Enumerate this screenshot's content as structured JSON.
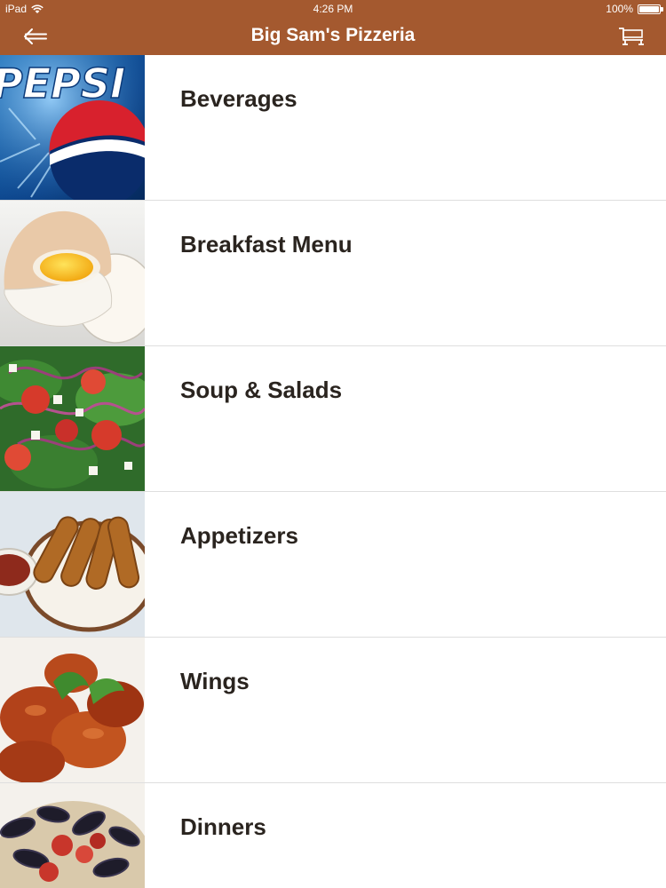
{
  "status_bar": {
    "device": "iPad",
    "time": "4:26 PM",
    "battery": "100%"
  },
  "header": {
    "title": "Big Sam's Pizzeria",
    "back_icon": "back-arrow-icon",
    "cart_icon": "shopping-cart-icon",
    "background_color": "#a4592f"
  },
  "menu": {
    "items": [
      {
        "label": "Beverages",
        "image": "pepsi-image"
      },
      {
        "label": "Breakfast Menu",
        "image": "egg-image"
      },
      {
        "label": "Soup & Salads",
        "image": "salad-image"
      },
      {
        "label": "Appetizers",
        "image": "mozzarella-sticks-image"
      },
      {
        "label": "Wings",
        "image": "wings-image"
      },
      {
        "label": "Dinners",
        "image": "mussels-pasta-image"
      }
    ]
  }
}
